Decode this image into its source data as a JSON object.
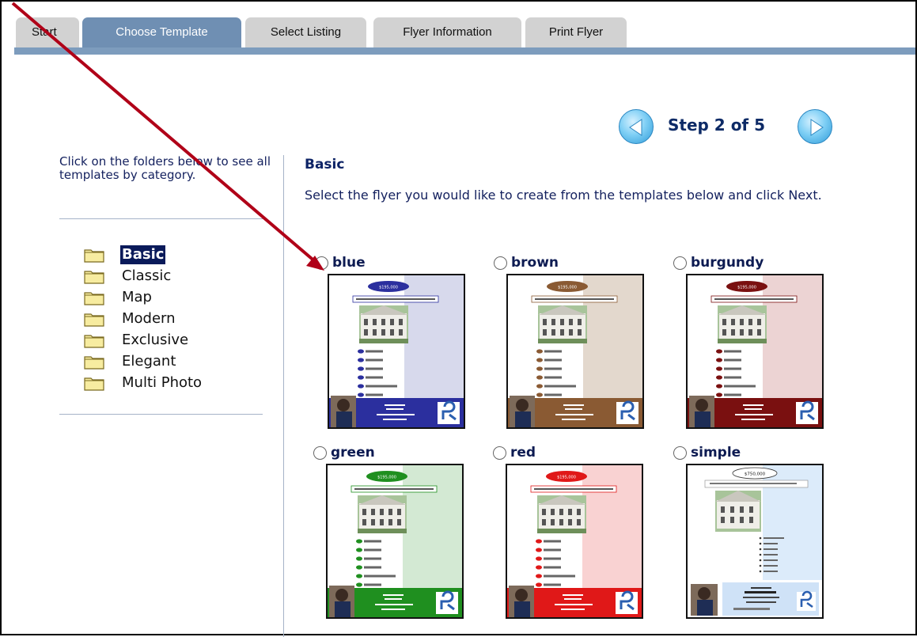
{
  "tabs": [
    {
      "label": "Start"
    },
    {
      "label": "Choose Template"
    },
    {
      "label": "Select Listing"
    },
    {
      "label": "Flyer Information"
    },
    {
      "label": "Print Flyer"
    }
  ],
  "active_tab": "Choose Template",
  "step": {
    "text": "Step 2 of 5",
    "prev_icon": "left-arrow-icon",
    "next_icon": "right-arrow-icon"
  },
  "left": {
    "instruction": "Click on the folders below to see all templates by category.",
    "folders": [
      {
        "label": "Basic",
        "selected": true
      },
      {
        "label": "Classic"
      },
      {
        "label": "Map"
      },
      {
        "label": "Modern"
      },
      {
        "label": "Exclusive"
      },
      {
        "label": "Elegant"
      },
      {
        "label": "Multi Photo"
      }
    ]
  },
  "main": {
    "category_title": "Basic",
    "instruction": "Select the flyer you would like to create from the templates below and click Next.",
    "templates": [
      {
        "name": "blue",
        "accent": "#2b2f9e",
        "bg": "#d7d9ec"
      },
      {
        "name": "brown",
        "accent": "#8a5a33",
        "bg": "#e3d8cd"
      },
      {
        "name": "burgundy",
        "accent": "#7a1010",
        "bg": "#ecd3d3"
      },
      {
        "name": "green",
        "accent": "#1f8f1f",
        "bg": "#d3e9d3"
      },
      {
        "name": "red",
        "accent": "#e01818",
        "bg": "#f9d2d2"
      },
      {
        "name": "simple",
        "accent": "#6aa6de",
        "bg": "#dcebfa"
      }
    ],
    "thumb_price": "$195,000",
    "thumb_simple_price": "$750,000"
  },
  "colors": {
    "tab_active": "#6f8fb3",
    "tab_inactive": "#d2d2d2",
    "annotation_arrow": "#b00018",
    "title_text": "#0d2366"
  }
}
